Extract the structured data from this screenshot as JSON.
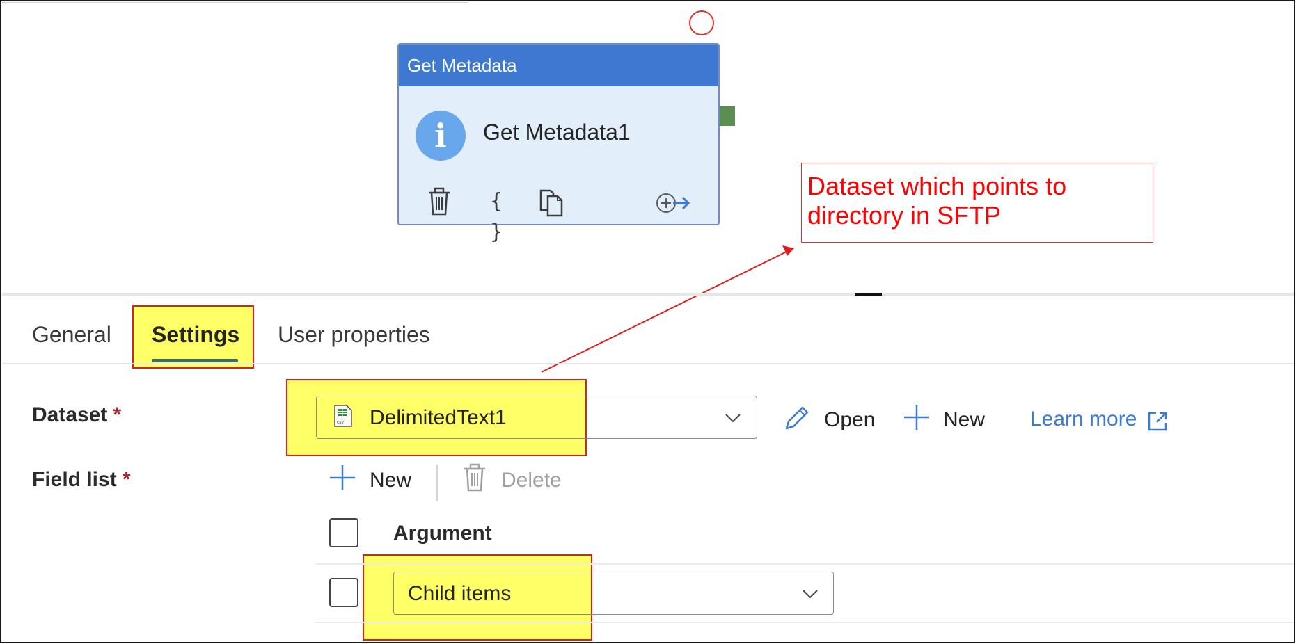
{
  "activity": {
    "type_label": "Get Metadata",
    "name": "Get Metadata1",
    "info_glyph": "i",
    "actions": [
      "delete-icon",
      "code-braces-icon",
      "copy-icon",
      "add-output-icon"
    ],
    "braces_glyph": "{ }"
  },
  "callout": {
    "text_line1": "Dataset which points to",
    "text_line2": "directory in SFTP",
    "color": "#ff0000"
  },
  "tabs": [
    {
      "label": "General",
      "active": false
    },
    {
      "label": "Settings",
      "active": true
    },
    {
      "label": "User properties",
      "active": false
    }
  ],
  "settings": {
    "dataset": {
      "label": "Dataset",
      "required_mark": "*",
      "value": "DelimitedText1",
      "open_label": "Open",
      "new_label": "New",
      "learn_more_label": "Learn more"
    },
    "field_list": {
      "label": "Field list",
      "required_mark": "*",
      "new_label": "New",
      "delete_label": "Delete",
      "column_header": "Argument",
      "rows": [
        {
          "argument": "Child items"
        }
      ]
    }
  },
  "colors": {
    "header_blue": "#3f78d1",
    "node_background": "#e3eefb",
    "highlight_yellow": "#ffff66",
    "annotation_red": "#e01e1e",
    "link_blue": "#3b7bd0",
    "tab_underline": "#3f6b57"
  }
}
